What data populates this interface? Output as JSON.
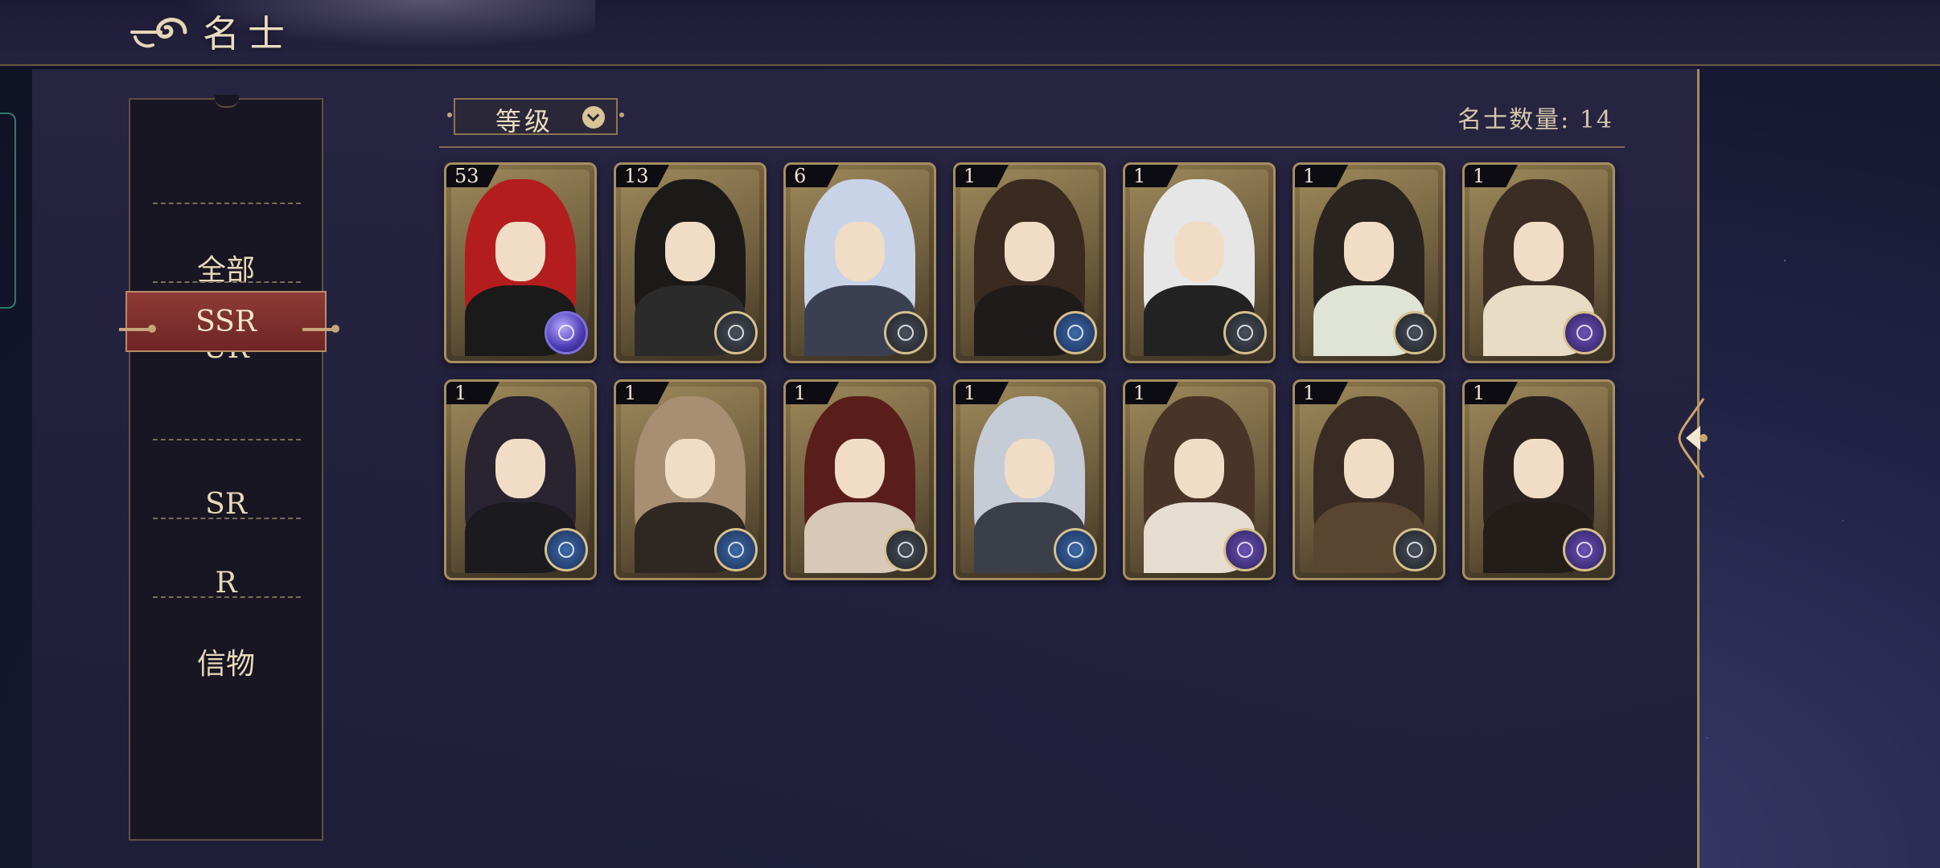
{
  "header": {
    "title": "名士"
  },
  "sidebar": {
    "items": [
      {
        "label": "全部",
        "active": false
      },
      {
        "label": "UR",
        "active": false
      },
      {
        "label": "SSR",
        "active": true
      },
      {
        "label": "SR",
        "active": false
      },
      {
        "label": "R",
        "active": false
      },
      {
        "label": "信物",
        "active": false
      }
    ]
  },
  "filter": {
    "label": "等级"
  },
  "count": {
    "label": "名士数量: 14"
  },
  "cards": [
    {
      "level": "53",
      "hair": "#b31d1d",
      "outfit": "#1a1a1a",
      "emblem": "orb"
    },
    {
      "level": "13",
      "hair": "#1c1a18",
      "outfit": "#2b2b2b",
      "emblem": "dark"
    },
    {
      "level": "6",
      "hair": "#c9d3e8",
      "outfit": "#3a3f52",
      "emblem": "dark"
    },
    {
      "level": "1",
      "hair": "#3a2a20",
      "outfit": "#1f1b1a",
      "emblem": "blue"
    },
    {
      "level": "1",
      "hair": "#e6e6e6",
      "outfit": "#222222",
      "emblem": "dark"
    },
    {
      "level": "1",
      "hair": "#2a2420",
      "outfit": "#e0e4d6",
      "emblem": "dark"
    },
    {
      "level": "1",
      "hair": "#3b2c24",
      "outfit": "#e8dcc4",
      "emblem": "purple"
    },
    {
      "level": "1",
      "hair": "#2a2330",
      "outfit": "#1b1b1f",
      "emblem": "blue"
    },
    {
      "level": "1",
      "hair": "#a88e72",
      "outfit": "#2e2722",
      "emblem": "blue"
    },
    {
      "level": "1",
      "hair": "#5a1e1a",
      "outfit": "#d8c8b8",
      "emblem": "dark"
    },
    {
      "level": "1",
      "hair": "#c5ccd6",
      "outfit": "#3a3f4a",
      "emblem": "blue"
    },
    {
      "level": "1",
      "hair": "#4a3428",
      "outfit": "#e6ddd0",
      "emblem": "purple"
    },
    {
      "level": "1",
      "hair": "#3a2c24",
      "outfit": "#5a4530",
      "emblem": "dark"
    },
    {
      "level": "1",
      "hair": "#2a2220",
      "outfit": "#231d1a",
      "emblem": "purple"
    }
  ]
}
